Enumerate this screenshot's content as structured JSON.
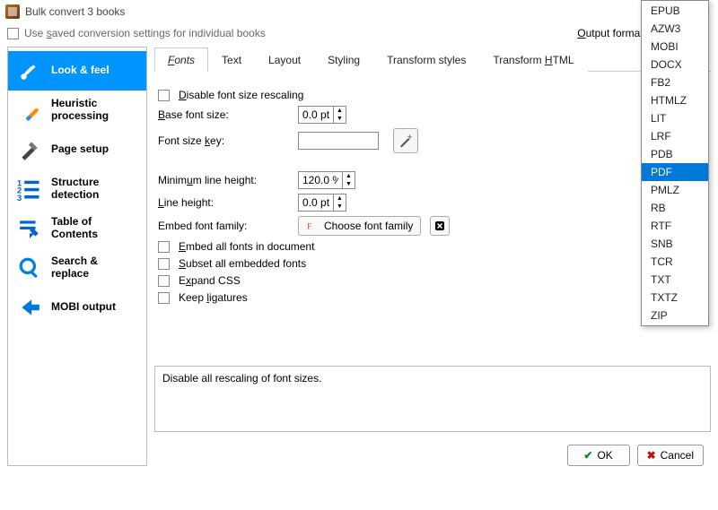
{
  "window": {
    "title": "Bulk convert 3 books"
  },
  "top": {
    "saved_settings_label": "Use saved conversion settings for individual books",
    "output_format_label": "Output format:"
  },
  "sidebar": {
    "items": [
      {
        "label": "Look & feel"
      },
      {
        "label": "Heuristic processing"
      },
      {
        "label": "Page setup"
      },
      {
        "label": "Structure detection"
      },
      {
        "label": "Table of Contents"
      },
      {
        "label": "Search & replace"
      },
      {
        "label": "MOBI output"
      }
    ]
  },
  "tabs": [
    {
      "label": "Fonts"
    },
    {
      "label": "Text"
    },
    {
      "label": "Layout"
    },
    {
      "label": "Styling"
    },
    {
      "label": "Transform styles"
    },
    {
      "label": "Transform HTML"
    }
  ],
  "fonts": {
    "disable_rescaling": "Disable font size rescaling",
    "base_font_size": "Base font size:",
    "base_font_size_val": "0.0 pt",
    "font_size_key": "Font size key:",
    "min_line_height": "Minimum line height:",
    "min_line_height_val": "120.0 %",
    "line_height": "Line height:",
    "line_height_val": "0.0 pt",
    "embed_family": "Embed font family:",
    "choose_font": "Choose font family",
    "embed_all": "Embed all fonts in document",
    "subset": "Subset all embedded fonts",
    "expand_css": "Expand CSS",
    "keep_ligatures": "Keep ligatures"
  },
  "help": "Disable all rescaling of font sizes.",
  "buttons": {
    "ok": "OK",
    "cancel": "Cancel"
  },
  "dropdown": {
    "options": [
      "EPUB",
      "AZW3",
      "MOBI",
      "DOCX",
      "FB2",
      "HTMLZ",
      "LIT",
      "LRF",
      "PDB",
      "PDF",
      "PMLZ",
      "RB",
      "RTF",
      "SNB",
      "TCR",
      "TXT",
      "TXTZ",
      "ZIP"
    ],
    "selected": "PDF"
  }
}
